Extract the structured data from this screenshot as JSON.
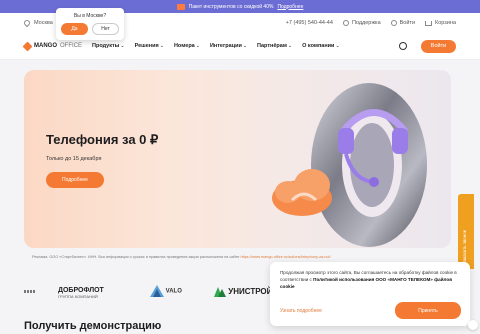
{
  "promo": {
    "text": "Пакет инструментов со скидкой 40%",
    "link": "Подробнее"
  },
  "util": {
    "city": "Москва",
    "phone": "+7 (495) 540-44-44",
    "support": "Поддержка",
    "login": "Войти",
    "cart": "Корзина"
  },
  "city_popup": {
    "question": "Вы в Москве?",
    "yes": "Да",
    "no": "Нет"
  },
  "nav": {
    "logo_brand": "MANGO",
    "logo_office": "OFFICE",
    "items": [
      "Продукты",
      "Решения",
      "Номера",
      "Интеграции",
      "Партнёрам",
      "О компании"
    ],
    "enter_label": "Войти"
  },
  "hero": {
    "title": "Телефония за 0 ₽",
    "subtitle": "Только до 15 декабря",
    "button": "Подробнее"
  },
  "legal": {
    "text": "Реклама. ООО «Стартбизнес». ИНН. Вся информация о сроках и правилах проведения акции расположена на сайте ",
    "link": "https://www.mango-office.ru/actions/telephony-za-nol/"
  },
  "logos": {
    "l1": "ДОБРОФЛОТ",
    "l1_sub": "ГРУППА КОМПАНИЙ",
    "l2": "VALO",
    "l3": "УНИСТРОЙ"
  },
  "section_title": "Получить демонстрацию",
  "side_tab": "Заказать звонок",
  "cookie": {
    "text_before": "Продолжая просмотр этого сайта, Вы соглашаетесь на обработку файлов cookie в соответствии с ",
    "policy": "Политикой использования ООО «МАНГО ТЕЛЕКОМ» файлов cookie",
    "link": "Узнать подробнее",
    "accept": "Принять"
  },
  "colors": {
    "accent": "#f47a33",
    "promo_bg": "#6c6dd4",
    "side_tab": "#f0a020"
  }
}
